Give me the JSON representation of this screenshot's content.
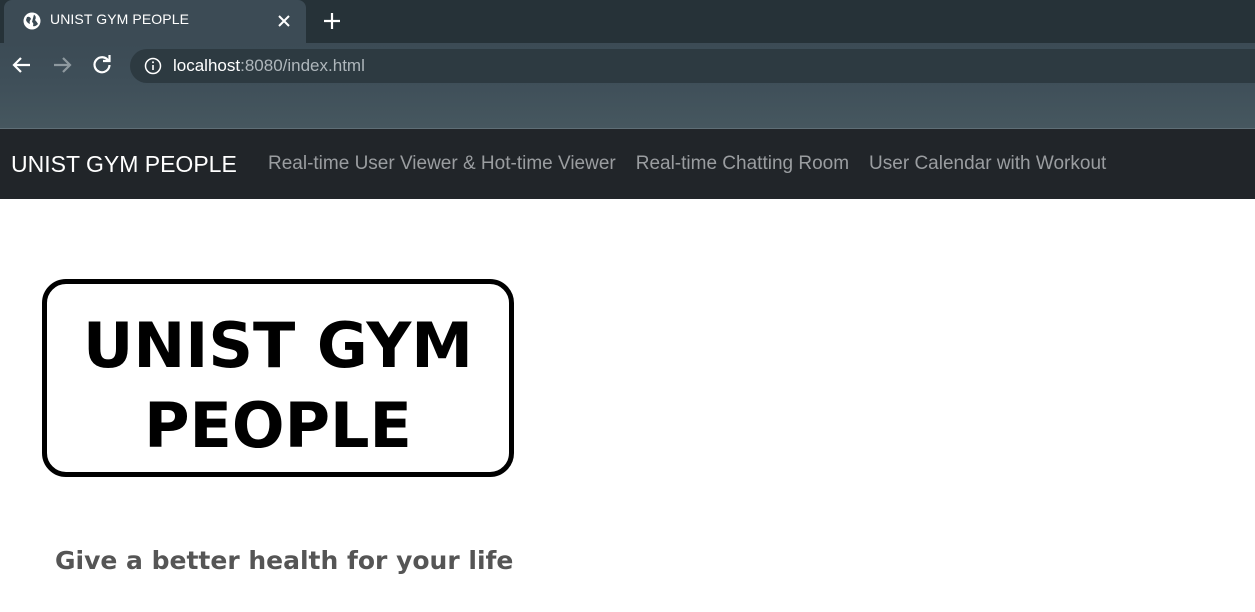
{
  "browser": {
    "tab_title": "UNIST GYM PEOPLE",
    "url_host": "localhost",
    "url_rest": ":8080/index.html",
    "icons": [
      "globe-icon",
      "close-icon",
      "plus-icon",
      "back-arrow-icon",
      "forward-arrow-icon",
      "reload-icon",
      "info-icon"
    ]
  },
  "navbar": {
    "brand": "UNIST GYM PEOPLE",
    "links": [
      {
        "label": "Real-time User Viewer & Hot-time Viewer"
      },
      {
        "label": "Real-time Chatting Room"
      },
      {
        "label": "User Calendar with Workout"
      }
    ]
  },
  "content": {
    "logo_line1": "UNIST GYM",
    "logo_line2": "PEOPLE",
    "tagline": "Give a better health for your life"
  },
  "colors": {
    "chrome_bg": "#263238",
    "navbar_bg": "#212529",
    "nav_link": "#9a9da0"
  }
}
